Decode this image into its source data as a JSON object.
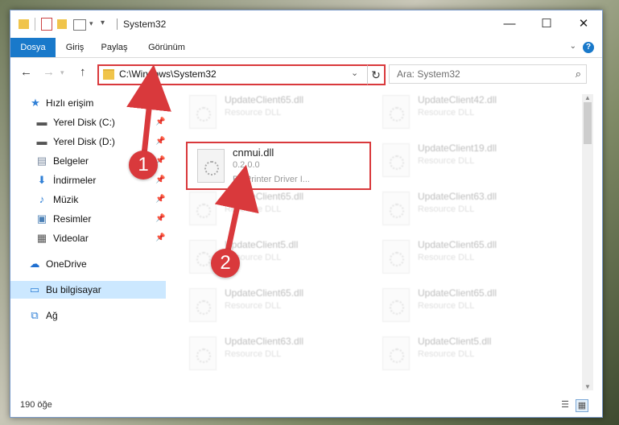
{
  "window": {
    "title": "System32",
    "minimize_glyph": "—",
    "maximize_glyph": "☐",
    "close_glyph": "✕"
  },
  "ribbon": {
    "tabs": [
      {
        "label": "Dosya",
        "active": true
      },
      {
        "label": "Giriş",
        "active": false
      },
      {
        "label": "Paylaş",
        "active": false
      },
      {
        "label": "Görünüm",
        "active": false
      }
    ],
    "help": "?"
  },
  "nav": {
    "back": "←",
    "forward": "→",
    "up": "↑",
    "address": "C:\\Windows\\System32",
    "refresh": "↻",
    "search_placeholder": "Ara: System32"
  },
  "sidebar": {
    "items": [
      {
        "label": "Hızlı erişim",
        "icon": "star-icon",
        "glyph": "★",
        "color": "#2f7fd6",
        "pinned": false,
        "selected": false
      },
      {
        "label": "Yerel Disk (C:)",
        "icon": "drive-icon",
        "glyph": "▬",
        "color": "#555555",
        "pinned": true,
        "selected": false
      },
      {
        "label": "Yerel Disk (D:)",
        "icon": "drive-icon",
        "glyph": "▬",
        "color": "#555555",
        "pinned": true,
        "selected": false
      },
      {
        "label": "Belgeler",
        "icon": "documents-icon",
        "glyph": "▤",
        "color": "#7a8aa0",
        "pinned": true,
        "selected": false
      },
      {
        "label": "İndirmeler",
        "icon": "download-icon",
        "glyph": "⬇",
        "color": "#2f7fd6",
        "pinned": true,
        "selected": false
      },
      {
        "label": "Müzik",
        "icon": "music-icon",
        "glyph": "♪",
        "color": "#2f7fd6",
        "pinned": true,
        "selected": false
      },
      {
        "label": "Resimler",
        "icon": "pictures-icon",
        "glyph": "▣",
        "color": "#4a7fb5",
        "pinned": true,
        "selected": false
      },
      {
        "label": "Videolar",
        "icon": "videos-icon",
        "glyph": "▦",
        "color": "#555555",
        "pinned": true,
        "selected": false
      },
      {
        "label": "OneDrive",
        "icon": "cloud-icon",
        "glyph": "☁",
        "color": "#1f6fd0",
        "pinned": false,
        "selected": false
      },
      {
        "label": "Bu bilgisayar",
        "icon": "computer-icon",
        "glyph": "▭",
        "color": "#2f7fd6",
        "pinned": false,
        "selected": true
      },
      {
        "label": "Ağ",
        "icon": "network-icon",
        "glyph": "⧉",
        "color": "#2f7fd6",
        "pinned": false,
        "selected": false
      }
    ]
  },
  "files": {
    "highlighted": {
      "name": "cnmui.dll",
      "version": "0.2.0.0",
      "description": "BJ Printer Driver I..."
    },
    "left_column": [
      {
        "name": "UpdateClient65.dll",
        "type": "Resource DLL"
      },
      {
        "name": "UpdateClient65.dll",
        "type": "Resource DLL"
      },
      {
        "name": "UpdateClient5.dll",
        "type": "Resource DLL"
      },
      {
        "name": "UpdateClient65.dll",
        "type": "Resource DLL"
      },
      {
        "name": "UpdateClient63.dll",
        "type": "Resource DLL"
      }
    ],
    "right_column": [
      {
        "name": "UpdateClient42.dll",
        "type": "Resource DLL"
      },
      {
        "name": "UpdateClient19.dll",
        "type": "Resource DLL"
      },
      {
        "name": "UpdateClient63.dll",
        "type": "Resource DLL"
      },
      {
        "name": "UpdateClient65.dll",
        "type": "Resource DLL"
      },
      {
        "name": "UpdateClient65.dll",
        "type": "Resource DLL"
      },
      {
        "name": "UpdateClient5.dll",
        "type": "Resource DLL"
      }
    ]
  },
  "status": {
    "count": "190 öğe"
  },
  "annotations": {
    "step1": "1",
    "step2": "2",
    "color": "#d9393c"
  }
}
